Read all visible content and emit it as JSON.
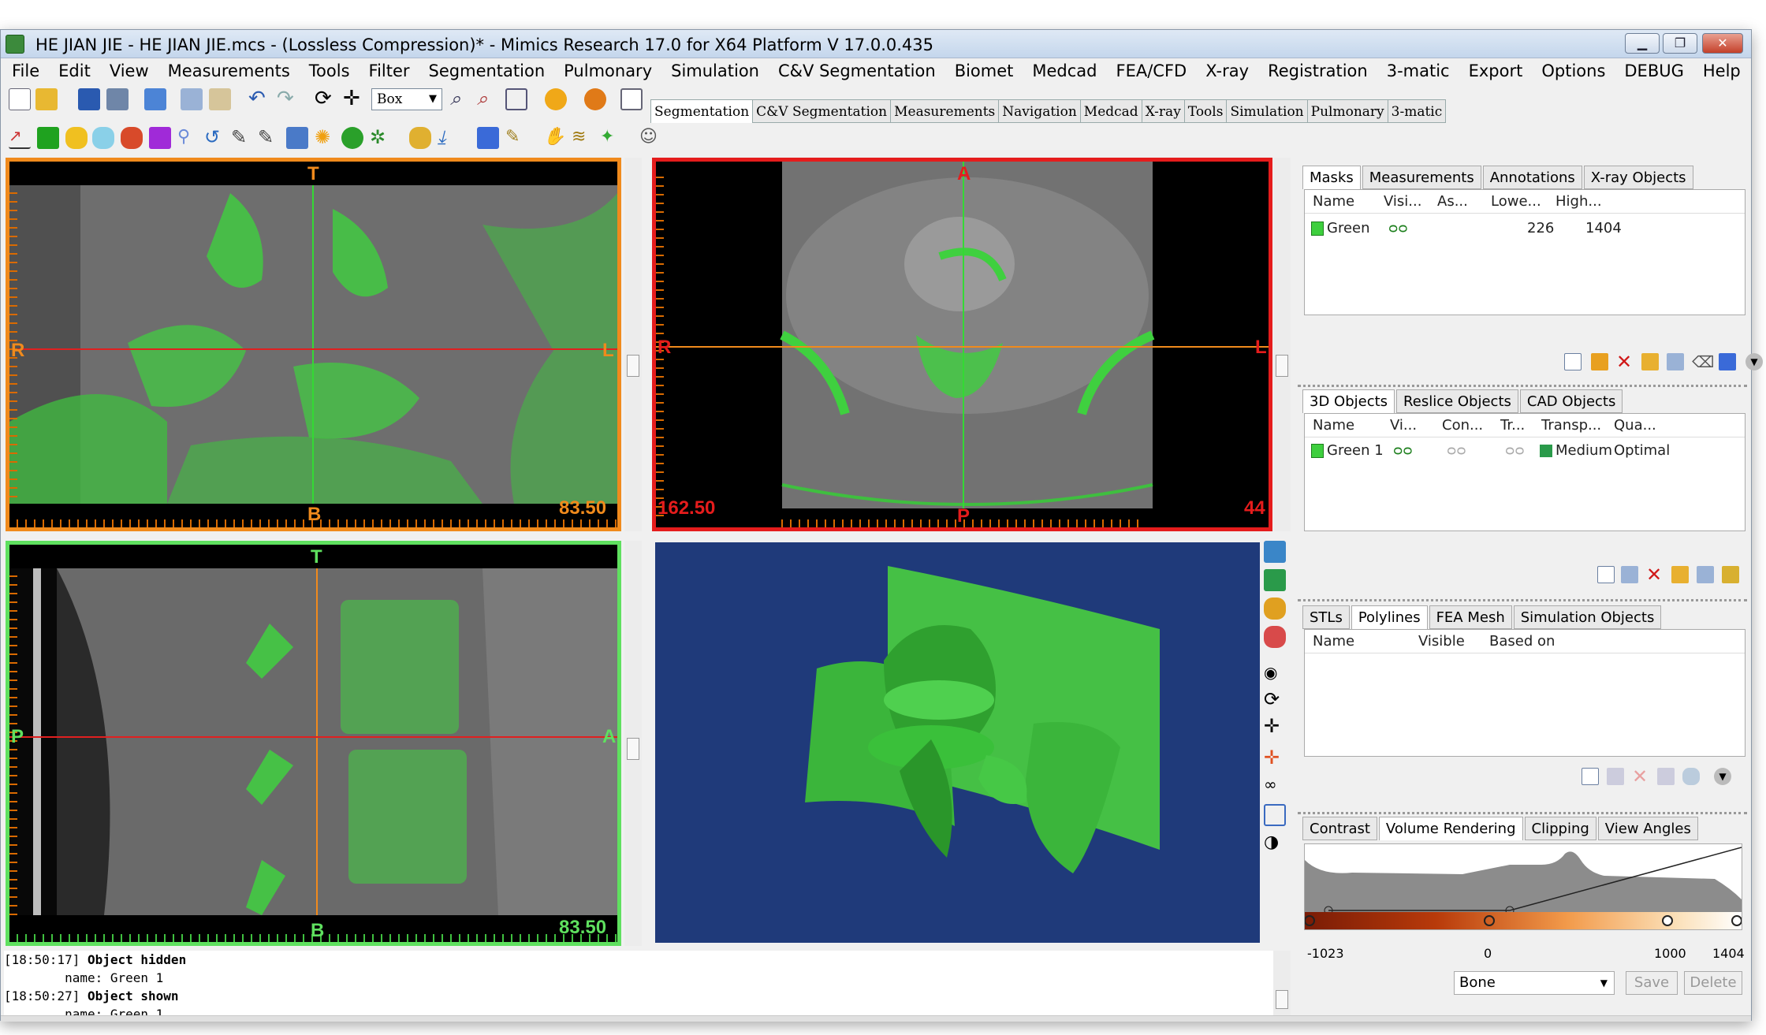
{
  "window": {
    "title": "HE JIAN JIE - HE JIAN JIE.mcs -  (Lossless Compression)* - Mimics Research 17.0 for X64 Platform V 17.0.0.435"
  },
  "menu": [
    "File",
    "Edit",
    "View",
    "Measurements",
    "Tools",
    "Filter",
    "Segmentation",
    "Pulmonary",
    "Simulation",
    "C&V Segmentation",
    "Biomet",
    "Medcad",
    "FEA/CFD",
    "X-ray",
    "Registration",
    "3-matic",
    "Export",
    "Options",
    "DEBUG",
    "Help"
  ],
  "toolbar": {
    "zoom_combo": "Box"
  },
  "page_tabs": [
    "Segmentation",
    "C&V Segmentation",
    "Measurements",
    "Navigation",
    "Medcad",
    "X-ray",
    "Tools",
    "Simulation",
    "Pulmonary",
    "3-matic"
  ],
  "views": {
    "coronal": {
      "top": "T",
      "bottom": "B",
      "left": "R",
      "right": "L",
      "value": "83.50",
      "border": "#f08a1c"
    },
    "axial": {
      "top": "A",
      "bottom": "P",
      "left": "R",
      "right": "L",
      "value_left": "162.50",
      "value_right": "44",
      "border": "#e51c1c"
    },
    "sagittal": {
      "top": "T",
      "bottom": "B",
      "left": "P",
      "right": "A",
      "value": "83.50",
      "border": "#5fe05f"
    }
  },
  "masks_panel": {
    "tabs": [
      "Masks",
      "Measurements",
      "Annotations",
      "X-ray Objects"
    ],
    "columns": [
      "Name",
      "Visi...",
      "As...",
      "Lowe...",
      "High..."
    ],
    "rows": [
      {
        "name": "Green",
        "lower": "226",
        "higher": "1404"
      }
    ]
  },
  "objects_panel": {
    "tabs": [
      "3D Objects",
      "Reslice Objects",
      "CAD Objects"
    ],
    "columns": [
      "Name",
      "Vi...",
      "Con...",
      "Tr...",
      "Transp...",
      "Qua..."
    ],
    "rows": [
      {
        "name": "Green 1",
        "transparency": "Medium",
        "quality": "Optimal"
      }
    ]
  },
  "stl_panel": {
    "tabs": [
      "STLs",
      "Polylines",
      "FEA Mesh",
      "Simulation Objects"
    ],
    "columns": [
      "Name",
      "Visible",
      "Based on"
    ]
  },
  "render_panel": {
    "tabs": [
      "Contrast",
      "Volume Rendering",
      "Clipping",
      "View Angles"
    ],
    "axis_labels": [
      "-1023",
      "0",
      "1000",
      "1404"
    ],
    "preset": "Bone",
    "save_label": "Save",
    "delete_label": "Delete"
  },
  "log": [
    {
      "time": "[18:50:17]",
      "message": "Object hidden",
      "detail": "        name: Green 1"
    },
    {
      "time": "[18:50:27]",
      "message": "Object shown",
      "detail": "        name: Green 1"
    }
  ],
  "colors": {
    "mask_green": "#3ecf3e",
    "viewport_3d_bg": "#1f3a7a",
    "coronal_border": "#f08a1c",
    "axial_border": "#e51c1c",
    "sagittal_border": "#5fe05f"
  }
}
